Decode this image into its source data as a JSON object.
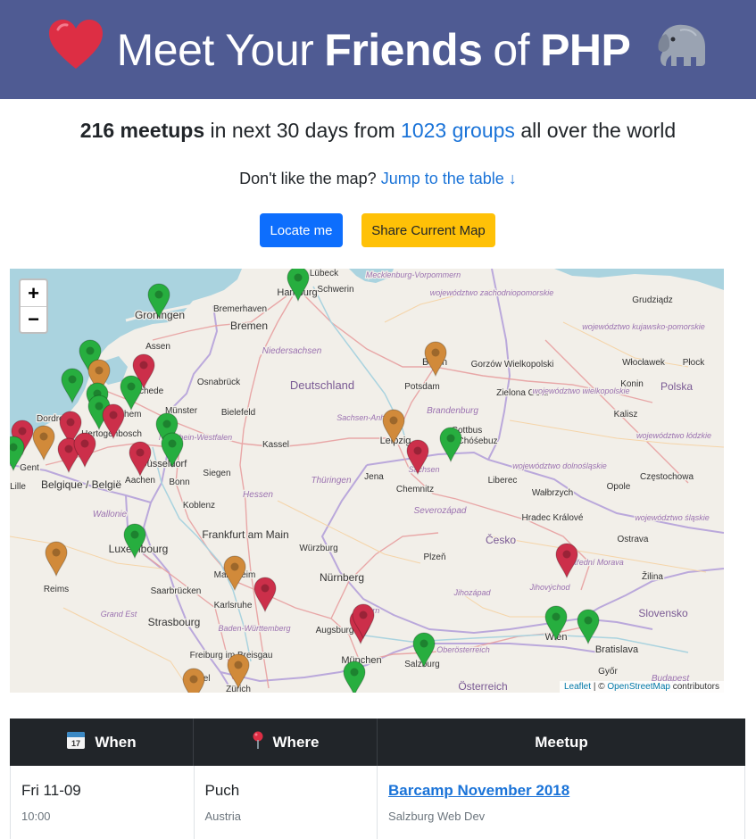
{
  "header": {
    "title_pre": "Meet Your",
    "title_bold1": "Friends",
    "title_mid": "of",
    "title_bold2": "PHP",
    "heart_icon": "heart-icon",
    "elephant_icon": "elephant-icon"
  },
  "stats": {
    "count": "216 meetups",
    "text1": "in next 30 days from",
    "groups_link": "1023 groups",
    "text2": "all over the world"
  },
  "jump": {
    "question": "Don't like the map?",
    "link": "Jump to the table ↓"
  },
  "buttons": {
    "locate": "Locate me",
    "share": "Share Current Map"
  },
  "map": {
    "zoom_in": "+",
    "zoom_out": "−",
    "attribution_leaflet": "Leaflet",
    "attribution_sep": "|",
    "attribution_copy": "©",
    "attribution_osm": "OpenStreetMap",
    "attribution_tail": "contributors",
    "marker_colors": {
      "green": "#27ae3f",
      "red": "#cc2f4a",
      "orange": "#d18a3a"
    },
    "cities": [
      "Lübeck",
      "Hamburg",
      "Schwerin",
      "Mecklenburg-Vorpommern",
      "województwo zachodniopomorskie",
      "Grudziądz",
      "Groningen",
      "Bremerhaven",
      "Bremen",
      "Assen",
      "województwo kujawsko-pomorskie",
      "Włocławek",
      "Płock",
      "Niedersachsen",
      "Berlin",
      "Gorzów Wielkopolski",
      "Osnabrück",
      "Deutschland",
      "Potsdam",
      "Zielona Góra",
      "województwo wielkopolskie",
      "Konin",
      "Polska",
      "Enschede",
      "Münster",
      "Bielefeld",
      "Brandenburg",
      "Sachsen-Anhalt",
      "Kalisz",
      "Dordrecht",
      "Hertogenbosch",
      "Arnhem",
      "Cottbus",
      "Chóśebuz",
      "województwo łódzkie",
      "Nordrhein-Westfalen",
      "Kassel",
      "Leipzig",
      "Gent",
      "Düsseldorf",
      "Sachsen",
      "województwo dolnośląskie",
      "Siegen",
      "Jena",
      "Aachen",
      "Bonn",
      "Chemnitz",
      "Liberec",
      "Częstochowa",
      "Lille",
      "Belgique / België",
      "Wallonie",
      "Hessen",
      "Thüringen",
      "Koblenz",
      "Wałbrzych",
      "Opole",
      "Severozápad",
      "Hradec Králové",
      "województwo śląskie",
      "Frankfurt am Main",
      "Würzburg",
      "Ostrava",
      "Luxembourg",
      "Plzeň",
      "Česko",
      "Střední Morava",
      "Mannheim",
      "Reims",
      "Saarbrücken",
      "Nürnberg",
      "Jihozápad",
      "Jihovýchod",
      "Žilina",
      "Karlsruhe",
      "Bayern",
      "Grand Est",
      "Strasbourg",
      "Baden-Württemberg",
      "Augsburg",
      "Slovensko",
      "Wien",
      "Bratislava",
      "Freiburg im Breisgau",
      "München",
      "Salzburg",
      "Oberösterreich",
      "Győr",
      "Basel",
      "Zürich",
      "Österreich",
      "Budapest"
    ]
  },
  "table": {
    "headers": {
      "when": "When",
      "where": "Where",
      "meetup": "Meetup",
      "when_icon": "calendar-icon",
      "where_icon": "pin-icon"
    },
    "rows": [
      {
        "date": "Fri 11-09",
        "time": "10:00",
        "city": "Puch",
        "country": "Austria",
        "title": "Barcamp November 2018",
        "group": "Salzburg Web Dev"
      }
    ]
  }
}
